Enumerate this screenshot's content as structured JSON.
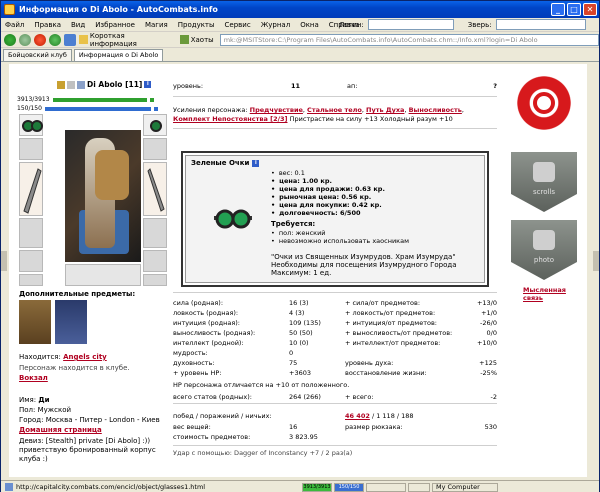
{
  "window": {
    "title": "Информация о Di Abolo - AutoCombats.info",
    "minimize": "_",
    "maximize": "□",
    "close": "✕"
  },
  "menu": {
    "items": [
      "Файл",
      "Правка",
      "Вид",
      "Избранное",
      "Магия",
      "Продукты",
      "Сервис",
      "Журнал",
      "Окна",
      "Справка"
    ],
    "login_label": "Логин:",
    "beast_label": "Зверь:"
  },
  "toolbar": {
    "short_info_label": "Короткая информация",
    "hacks_label": "Хаоты",
    "address": "mk:@MSITStore:C:\\Program Files\\AutoCombats.info\\AutoCombats.chm::/Info.xml?login=Di Abolo"
  },
  "tabs": [
    "Бойцовский клуб",
    "Информация о Di Abolo"
  ],
  "character": {
    "name": "Di Abolo [11]",
    "info_badge": "i",
    "hp": "3913/3913",
    "mana": "150/150",
    "extra_items_title": "Дополнительные предметы:",
    "location_label": "Находится:",
    "location_value": "Angels city",
    "in_club_text": "Персонаж находится в клубе.",
    "station": "Вокзал",
    "name_label": "Имя:",
    "name_value": "Ди",
    "gender_label": "Пол:",
    "gender_value": "Мужской",
    "city_label": "Город:",
    "city_value": "Москва - Питер - London - Киев",
    "homepage": "Домашняя страница",
    "motto_label": "Девиз:",
    "motto_value": "[Stealth] private [Di Abolo] :)) приветствую бронированный корпус клуба :)"
  },
  "top_stats": {
    "level_label": "уровень:",
    "level_value": "11",
    "ap_label": "ап:",
    "ap_value": "?",
    "boosts_label": "Усиления персонажа:",
    "boosts": [
      "Предчувствие",
      "Стальное тело",
      "Путь Духа",
      "Выносливость",
      "Комплект Непостоянства [2/3]"
    ],
    "boosts_suffix": "Пристрастие на силу +13 Холодный разум +10"
  },
  "item_popup": {
    "title": "Зеленые Очки",
    "info_badge": "i",
    "weight": "вес: 0.1",
    "price": "цена: 1.00 кр.",
    "sell_price": "цена для продажи: 0.63 кр.",
    "market_price": "рыночная цена: 0.56 кр.",
    "buy_price": "цена для покупки: 0.42 кр.",
    "durability": "долговечность: 6/500",
    "required_label": "Требуется:",
    "req_gender": "пол: женский",
    "req_chaos": "невозможно использовать хаосникам",
    "description": "\"Очки из Священных Изумрудов. Храм Изумруда\"",
    "visit_note": "Необходимы для посещения Изумрудного Города",
    "max_note": "Максимум: 1 ед."
  },
  "stats": {
    "rows": [
      {
        "l": "сила (родная):",
        "v": "16 (3)",
        "l2": "+ сила/от предметов:",
        "v2": "+13/0"
      },
      {
        "l": "ловкость (родная):",
        "v": "4 (3)",
        "l2": "+ ловкость/от предметов:",
        "v2": "+1/0"
      },
      {
        "l": "интуиция (родная):",
        "v": "109 (135)",
        "l2": "+ интуиция/от предметов:",
        "v2": "-26/0"
      },
      {
        "l": "выносливость (родная):",
        "v": "50 (50)",
        "l2": "+ выносливость/от предметов:",
        "v2": "0/0"
      },
      {
        "l": "интеллект (родной):",
        "v": "10 (0)",
        "l2": "+ интеллект/от предметов:",
        "v2": "+10/0"
      },
      {
        "l": "мудрость:",
        "v": "0",
        "l2": "",
        "v2": ""
      },
      {
        "l": "духовность:",
        "v": "75",
        "l2": "уровень духа:",
        "v2": "+125"
      },
      {
        "l": "+ уровень HP:",
        "v": "+3603",
        "l2": "восстановление жизни:",
        "v2": "-25%"
      }
    ],
    "hp_diff_note": "HP персонажа отличается на +10 от положенного.",
    "total_label": "всего статов (родных):",
    "total_value": "264 (266)",
    "total2_label": "+ всего:",
    "total2_value": "-2",
    "wins_label": "побед / поражений / ничьих:",
    "wins_link": "46 402",
    "wins_rest": "/ 1 118 / 188",
    "weight_label": "вес вещей:",
    "weight_value": "16",
    "bag_label": "размер рюкзака:",
    "bag_value": "530",
    "cost_label": "стоимость предметов:",
    "cost_value": "3 823.95",
    "cut_line": "Удар с помощью: Dagger of Inconstancy +7 / 2 раз(а)"
  },
  "right": {
    "scrolls_caption": "scrolls",
    "photo_caption": "photo",
    "mind_link": "Мысленная связь"
  },
  "statusbar": {
    "url": "http://capitalcity.combats.com/encicl/object/glasses1.html",
    "meter1": "3913/3913",
    "meter2": "150/150",
    "zone": "My Computer"
  }
}
